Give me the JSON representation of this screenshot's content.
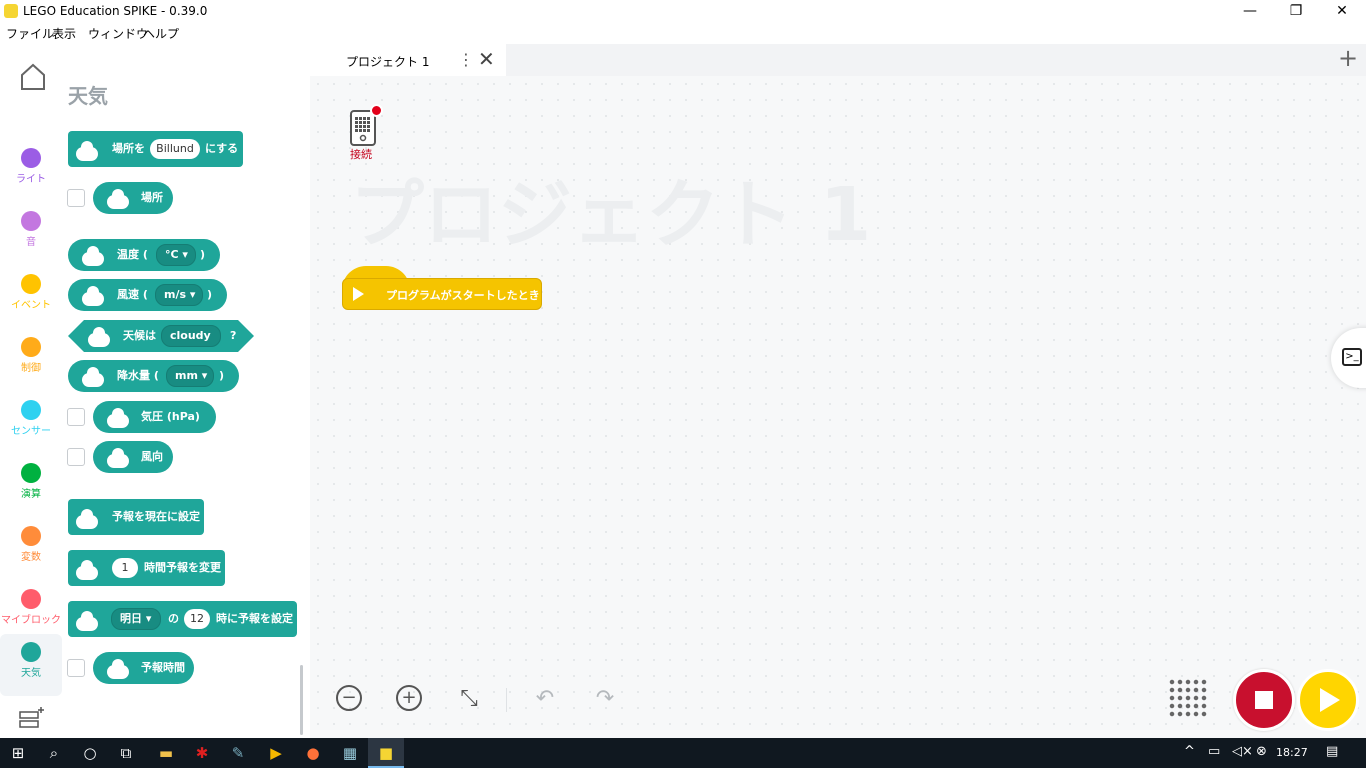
{
  "window": {
    "title": "LEGO Education SPIKE - 0.39.0",
    "minimize": "—",
    "restore": "❐",
    "close": "✕"
  },
  "menu": [
    "ファイル",
    "表示",
    "ウィンドウ",
    "ヘルプ"
  ],
  "categories": [
    {
      "label": "ライト",
      "color": "#9b5de5"
    },
    {
      "label": "音",
      "color": "#c377e0"
    },
    {
      "label": "イベント",
      "color": "#ffc300"
    },
    {
      "label": "制御",
      "color": "#ffab19"
    },
    {
      "label": "センサー",
      "color": "#2ed1f0"
    },
    {
      "label": "演算",
      "color": "#00b140"
    },
    {
      "label": "変数",
      "color": "#ff8c3a"
    },
    {
      "label": "マイブロック",
      "color": "#ff5c6b"
    },
    {
      "label": "天気",
      "color": "#1fa69a"
    }
  ],
  "palette": {
    "title": "天気",
    "blocks": {
      "set_location": {
        "pre": "場所を",
        "value": "Billund",
        "post": "にする"
      },
      "location": "場所",
      "temperature": {
        "pre": "温度 (",
        "unit": "°C",
        "post": ")"
      },
      "wind_speed": {
        "pre": "風速 (",
        "unit": "m/s",
        "post": ")"
      },
      "weather_is": {
        "pre": "天候は",
        "value": "cloudy",
        "post": "?"
      },
      "precipitation": {
        "pre": "降水量 (",
        "unit": "mm",
        "post": ")"
      },
      "pressure": "気圧 (hPa)",
      "wind_direction": "風向",
      "set_forecast_now": "予報を現在に設定",
      "change_forecast": {
        "value": "1",
        "post": "時間予報を変更"
      },
      "set_forecast_day": {
        "day": "明日",
        "mid": "の",
        "hour": "12",
        "post": "時に予報を設定"
      },
      "forecast_time": "予報時間"
    }
  },
  "tab": {
    "label": "プロジェクト 1",
    "menu": "⋮",
    "close": "✕",
    "add": "+"
  },
  "workspace": {
    "hub_label": "接続",
    "watermark": "プロジェクト 1",
    "start_block": "プログラムがスタートしたとき"
  },
  "toolbar": {
    "zoom_out": "−",
    "zoom_in": "+",
    "reset": "⤡",
    "undo": "↶",
    "redo": "↷"
  },
  "taskbar": {
    "time": "18:27"
  }
}
